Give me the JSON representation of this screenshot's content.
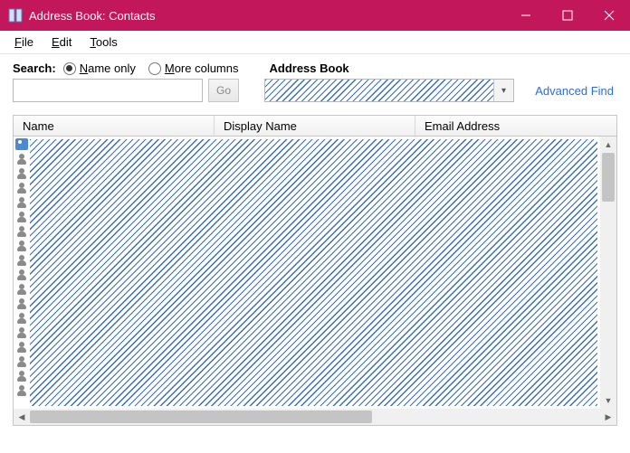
{
  "titlebar": {
    "title": "Address Book: Contacts"
  },
  "menu": {
    "file": "File",
    "edit": "Edit",
    "tools": "Tools"
  },
  "search": {
    "label": "Search:",
    "radio_name_only": "Name only",
    "radio_more_columns": "More columns",
    "selected": "name_only",
    "input_value": "",
    "go_label": "Go"
  },
  "address_book": {
    "label": "Address Book",
    "selected_text": ""
  },
  "advanced_find": "Advanced Find",
  "columns": {
    "name": "Name",
    "display_name": "Display Name",
    "email": "Email Address"
  },
  "contact_row_count": 18
}
